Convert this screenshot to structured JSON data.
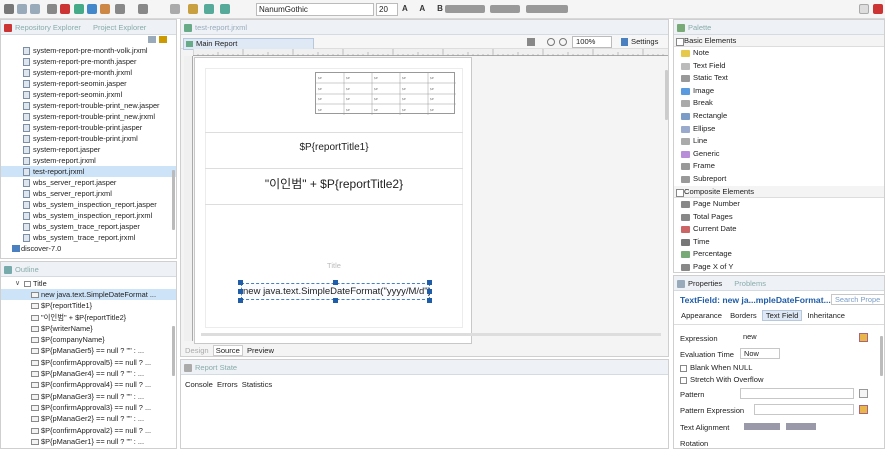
{
  "toolbar": {
    "font_name": "NanumGothic",
    "font_size": "20"
  },
  "repository": {
    "tab_label": "Repository Explorer",
    "tab2_label": "Project Explorer",
    "files": [
      "system-report-pre-month-volk.jrxml",
      "system-report-pre-month.jasper",
      "system-report-pre-month.jrxml",
      "system-report-seomin.jasper",
      "system-report-seomin.jrxml",
      "system-report-trouble-print_new.jasper",
      "system-report-trouble-print_new.jrxml",
      "system-report-trouble-print.jasper",
      "system-report-trouble-print.jrxml",
      "system-report.jasper",
      "system-report.jrxml",
      "test-report.jrxml",
      "wbs_server_report.jasper",
      "wbs_server_report.jrxml",
      "wbs_system_inspection_report.jasper",
      "wbs_system_inspection_report.jrxml",
      "wbs_system_trace_report.jasper",
      "wbs_system_trace_report.jrxml"
    ],
    "folder": "discover-7.0"
  },
  "outline": {
    "tab_label": "Outline",
    "root": "Title",
    "items": [
      "new java.text.SimpleDateFormat ...",
      "$P{reportTitle1}",
      "\"이인범\" + $P{reportTitle2}",
      "$P{writerName}",
      "$P{companyName}",
      "$P{pManaGer5} == null ? \"\" : ...",
      "$P{confirmApproval5} == null ? ...",
      "$P{pManaGer4} == null ? \"\" : ...",
      "$P{confirmApproval4} == null ? ...",
      "$P{pManaGer3} == null ? \"\" : ...",
      "$P{confirmApproval3} == null ? ...",
      "$P{pManaGer2} == null ? \"\" : ...",
      "$P{confirmApproval2} == null ? ...",
      "$P{pManaGer1} == null ? \"\" : ...",
      "$P{confirmApproval1} == null ? ..."
    ]
  },
  "editor": {
    "file_tab": "test-report.jrxml",
    "report_tab": "Main Report",
    "zoom": "100%",
    "settings": "Settings",
    "field_title1": "$P{reportTitle1}",
    "field_title2": "\"이인범\" + $P{reportTitle2}",
    "band_label": "Title",
    "date_expr": "new java.text.SimpleDateFormat(\"yyyy/M/d\")",
    "bottom_tabs": [
      "Design",
      "Source",
      "Preview"
    ]
  },
  "report_state": {
    "tab_label": "Report State",
    "tabs": [
      "Console",
      "Errors",
      "Statistics"
    ]
  },
  "palette": {
    "tab_label": "Palette",
    "basic_header": "Basic Elements",
    "basic_items": [
      "Note",
      "Text Field",
      "Static Text",
      "Image",
      "Break",
      "Rectangle",
      "Ellipse",
      "Line",
      "Generic",
      "Frame",
      "Subreport"
    ],
    "composite_header": "Composite Elements",
    "composite_items": [
      "Page Number",
      "Total Pages",
      "Current Date",
      "Time",
      "Percentage",
      "Page X of Y"
    ]
  },
  "properties": {
    "tab_label": "Properties",
    "tab2_label": "Problems",
    "title": "TextField: new ja...mpleDateFormat...",
    "search_placeholder": "Search Prope",
    "subtabs": [
      "Appearance",
      "Borders",
      "Text Field",
      "Inheritance"
    ],
    "expression_label": "Expression",
    "expression_value": "new",
    "eval_time_label": "Evaluation Time",
    "eval_time_value": "Now",
    "blank_when_null": "Blank When NULL",
    "stretch_overflow": "Stretch With Overflow",
    "pattern_label": "Pattern",
    "pattern_expr_label": "Pattern Expression",
    "text_alignment_label": "Text Alignment",
    "rotation_label": "Rotation"
  },
  "colors": {
    "accent": "#1f5da8",
    "selection": "#cde3f7",
    "tab_bg": "#eef2f7"
  }
}
